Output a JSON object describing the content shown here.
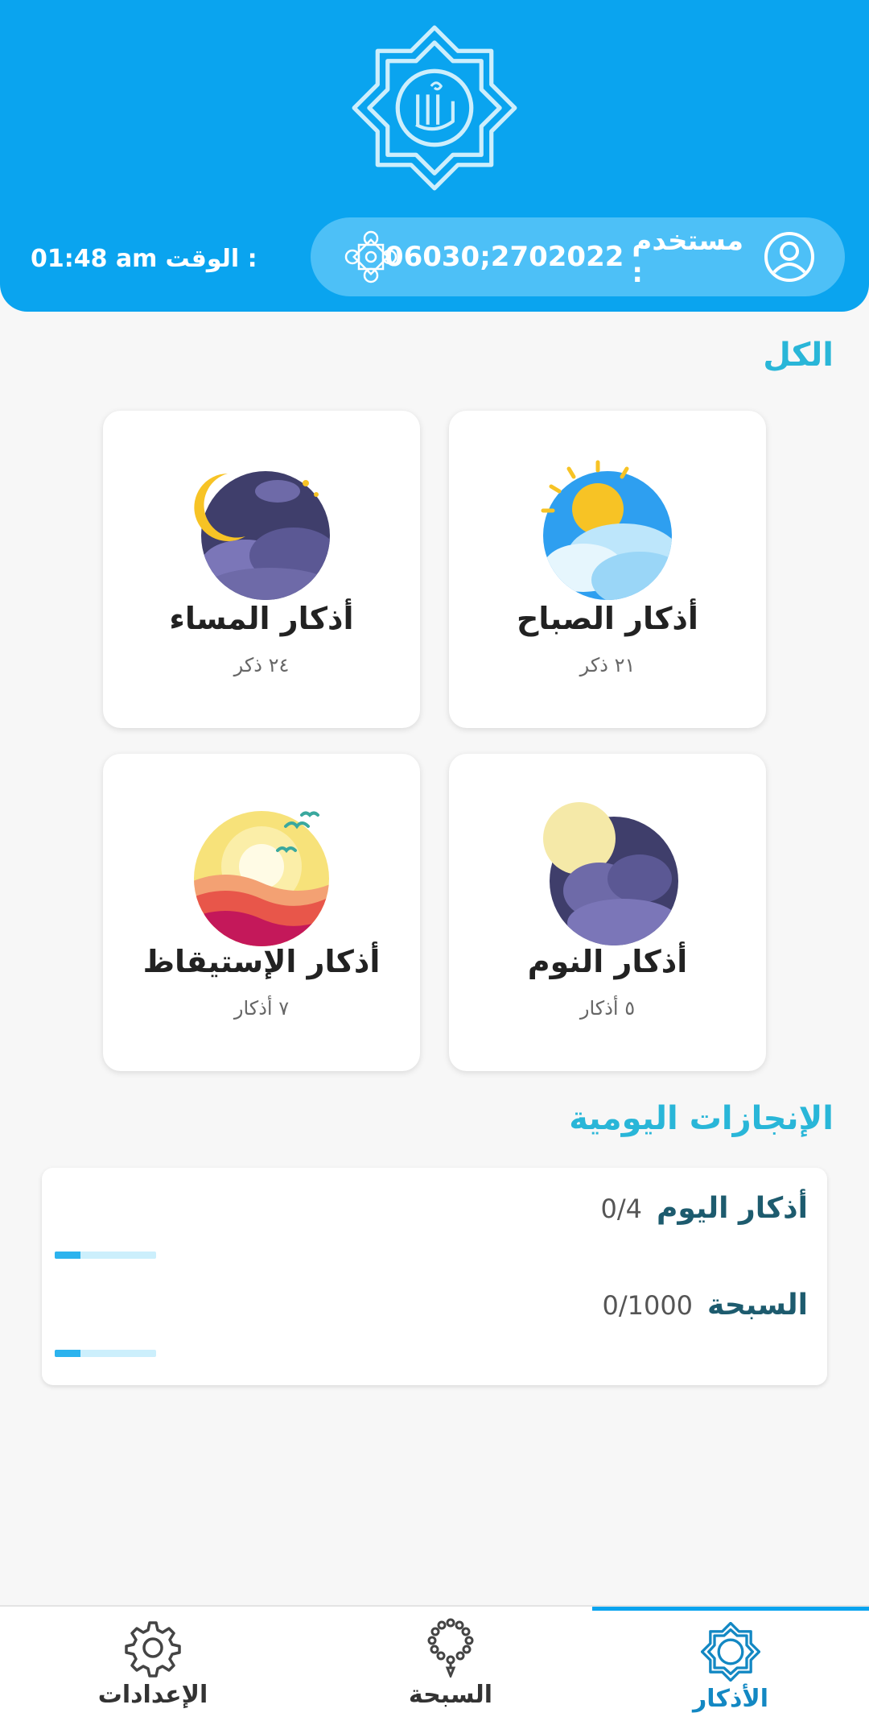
{
  "header": {
    "time_label": "الوقت :",
    "time_value": "01:48 am",
    "user_label": "مستخدم :",
    "user_id": "06030;2702022"
  },
  "sections": {
    "all_title": "الكل",
    "achievements_title": "الإنجازات اليومية"
  },
  "cards": [
    {
      "title": "أذكار الصباح",
      "subtitle": "٢١ ذكر",
      "icon": "morning-sun-icon"
    },
    {
      "title": "أذكار المساء",
      "subtitle": "٢٤ ذكر",
      "icon": "evening-moon-icon"
    },
    {
      "title": "أذكار النوم",
      "subtitle": "٥ أذكار",
      "icon": "sleep-moon-icon"
    },
    {
      "title": "أذكار الإستيقاظ",
      "subtitle": "٧ أذكار",
      "icon": "wakeup-sunrise-icon"
    }
  ],
  "achievements": [
    {
      "label": "أذكار اليوم",
      "count": "0/4",
      "progress": 0.25
    },
    {
      "label": "السبحة",
      "count": "0/1000",
      "progress": 0.25
    }
  ],
  "nav": [
    {
      "label": "الأذكار",
      "icon": "allah-star-icon",
      "active": true
    },
    {
      "label": "السبحة",
      "icon": "prayer-beads-icon",
      "active": false
    },
    {
      "label": "الإعدادات",
      "icon": "gear-icon",
      "active": false
    }
  ],
  "colors": {
    "primary": "#0aa4ef",
    "pill": "#4dc0f7",
    "accent_title": "#29b6d8",
    "achievement_label": "#1d5b6e",
    "progress_fill": "#2cb3ee",
    "progress_track": "#cceffc"
  }
}
